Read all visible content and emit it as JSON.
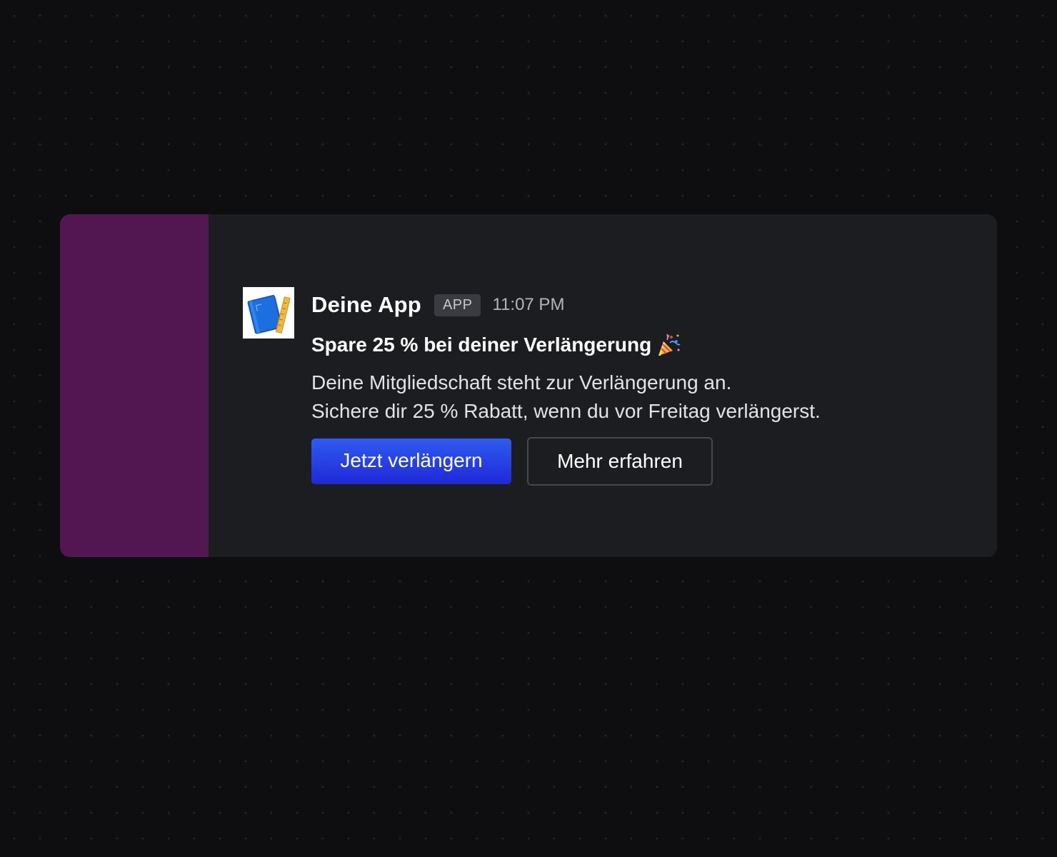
{
  "message": {
    "app_name": "Deine App",
    "badge": "APP",
    "timestamp": "11:07 PM",
    "app_icon": "blueprint-notebook-icon",
    "headline": "Spare 25 % bei deiner Verlängerung",
    "headline_icon": "party-popper-icon",
    "body_lines": [
      "Deine Mitgliedschaft steht zur Verlängerung an.",
      "Sichere dir 25 % Rabatt, wenn du vor Freitag verlängerst."
    ]
  },
  "actions": {
    "primary_label": "Jetzt verlängern",
    "secondary_label": "Mehr erfahren"
  },
  "colors": {
    "accent_panel": "#521650",
    "card_background": "#1c1d21",
    "page_background": "#0e0e10",
    "primary_button": "#2a44e6"
  }
}
